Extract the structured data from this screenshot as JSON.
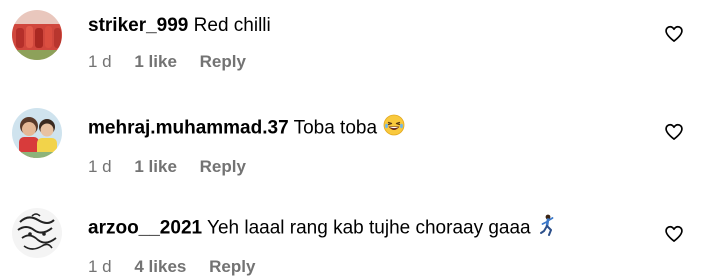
{
  "comments": [
    {
      "username": "striker_999",
      "text": "Red chilli",
      "time": "1 d",
      "likes": "1 like",
      "reply": "Reply"
    },
    {
      "username": "mehraj.muhammad.37",
      "text": "Toba toba",
      "time": "1 d",
      "likes": "1 like",
      "reply": "Reply",
      "emoji": "laughing-face-icon"
    },
    {
      "username": "arzoo__2021",
      "text": "Yeh laaal rang kab tujhe choraay gaaa",
      "time": "1 d",
      "likes": "4 likes",
      "reply": "Reply",
      "emoji": "dancing-person-icon"
    }
  ],
  "colors": {
    "text": "#000000",
    "meta": "#737373",
    "background": "#ffffff"
  }
}
